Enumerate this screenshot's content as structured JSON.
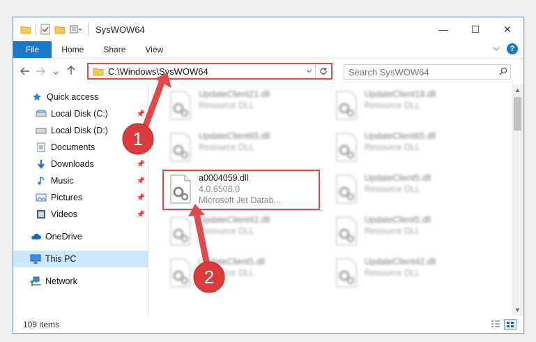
{
  "window": {
    "title": "SysWOW64",
    "controls": {
      "minimize": "—",
      "maximize": "☐",
      "close": "✕"
    }
  },
  "ribbon": {
    "tabs": [
      {
        "label": "File"
      },
      {
        "label": "Home"
      },
      {
        "label": "Share"
      },
      {
        "label": "View"
      }
    ],
    "help": "?"
  },
  "navigation": {
    "address": "C:\\Windows\\SysWOW64",
    "search_placeholder": "Search SysWOW64"
  },
  "sidebar": {
    "items": [
      {
        "label": "Quick access",
        "icon": "star-icon"
      },
      {
        "label": "Local Disk (C:)",
        "icon": "drive-icon",
        "pinned": true
      },
      {
        "label": "Local Disk (D:)",
        "icon": "drive-icon"
      },
      {
        "label": "Documents",
        "icon": "documents-icon",
        "pinned": true
      },
      {
        "label": "Downloads",
        "icon": "downloads-icon",
        "pinned": true
      },
      {
        "label": "Music",
        "icon": "music-icon",
        "pinned": true
      },
      {
        "label": "Pictures",
        "icon": "pictures-icon",
        "pinned": true
      },
      {
        "label": "Videos",
        "icon": "videos-icon",
        "pinned": true
      },
      {
        "label": "OneDrive",
        "icon": "cloud-icon"
      },
      {
        "label": "This PC",
        "icon": "computer-icon",
        "selected": true
      },
      {
        "label": "Network",
        "icon": "network-icon"
      }
    ]
  },
  "files": {
    "left": [
      {
        "name": "UpdateClient21.dll",
        "desc": "Resource DLL"
      },
      {
        "name": "UpdateClient65.dll",
        "desc": "Resource DLL"
      },
      {
        "name": "a0004059.dll",
        "version": "4.0.6508.0",
        "desc": "Microsoft Jet Datab..."
      },
      {
        "name": "UpdateClient42.dll",
        "desc": "Resource DLL"
      },
      {
        "name": "UpdateClient5.dll",
        "desc": "Resource DLL"
      }
    ],
    "right": [
      {
        "name": "UpdateClient19.dll",
        "desc": "Resource DLL"
      },
      {
        "name": "UpdateClient65.dll",
        "desc": "Resource DLL"
      },
      {
        "name": "UpdateClient5.dll",
        "desc": "Resource DLL"
      },
      {
        "name": "UpdateClient5.dll",
        "desc": "Resource DLL"
      },
      {
        "name": "UpdateClient42.dll",
        "desc": "Resource DLL"
      }
    ]
  },
  "status": {
    "item_count": "109 items"
  },
  "annotations": [
    {
      "label": "1",
      "color": "#e24a4a"
    },
    {
      "label": "2",
      "color": "#e24a4a"
    }
  ]
}
